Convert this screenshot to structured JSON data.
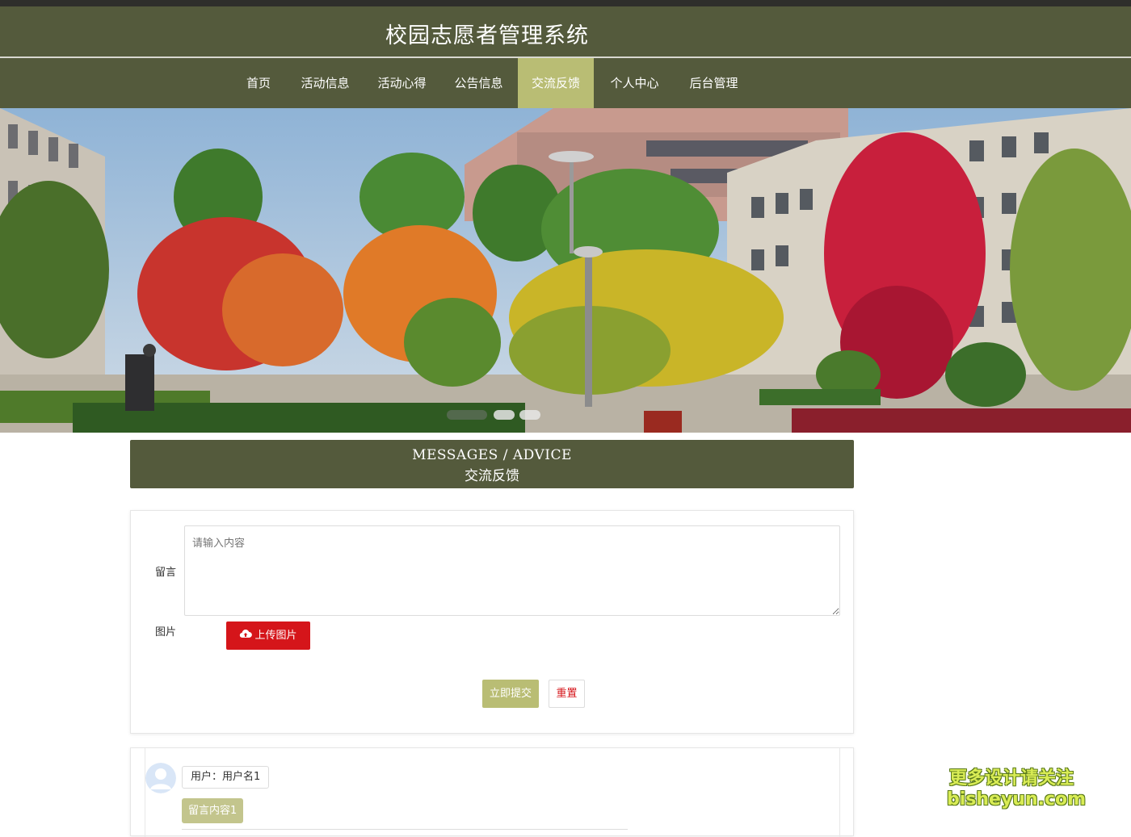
{
  "app": {
    "title": "校园志愿者管理系统"
  },
  "nav": {
    "items": [
      {
        "label": "首页"
      },
      {
        "label": "活动信息"
      },
      {
        "label": "活动心得"
      },
      {
        "label": "公告信息"
      },
      {
        "label": "交流反馈",
        "active": true
      },
      {
        "label": "个人中心"
      },
      {
        "label": "后台管理"
      }
    ]
  },
  "section": {
    "title_en": "MESSAGES / ADVICE",
    "title_cn": "交流反馈"
  },
  "form": {
    "message_label": "留言",
    "message_placeholder": "请输入内容",
    "image_label": "图片",
    "upload_label": "上传图片",
    "submit_label": "立即提交",
    "reset_label": "重置"
  },
  "messages": [
    {
      "user": "用户：用户名1",
      "content": "留言内容1"
    }
  ],
  "watermark": {
    "line1": "更多设计请关注",
    "line2": "bisheyun.com"
  },
  "colors": {
    "header": "#545a3c",
    "accent": "#b9bd74",
    "danger": "#d5151a"
  },
  "icons": {
    "upload": "cloud-upload-icon",
    "avatar": "user-avatar-icon"
  }
}
